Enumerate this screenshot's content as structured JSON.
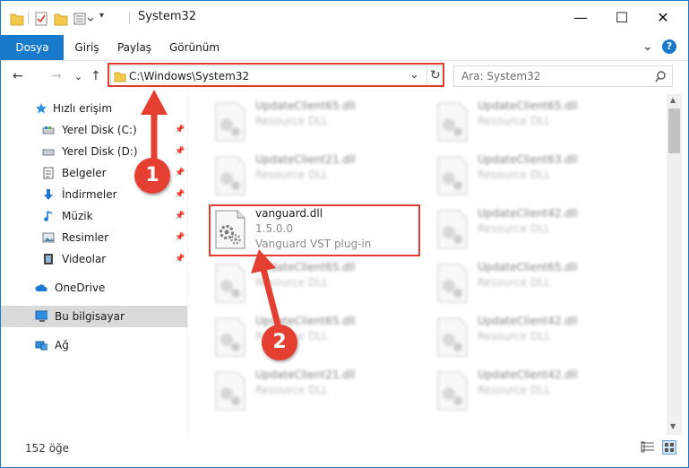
{
  "window": {
    "title": "System32",
    "minimize_glyph": "—",
    "maximize_glyph": "☐",
    "close_glyph": "✕",
    "help_glyph": "?",
    "expand_ribbon_glyph": "⌄"
  },
  "ribbon": {
    "tabs": [
      {
        "label": "Dosya"
      },
      {
        "label": "Giriş"
      },
      {
        "label": "Paylaş"
      },
      {
        "label": "Görünüm"
      }
    ]
  },
  "address": {
    "path": "C:\\Windows\\System32",
    "dropdown_glyph": "⌄",
    "refresh_glyph": "↻"
  },
  "nav_buttons": {
    "back": "←",
    "forward": "→",
    "recent": "⌄",
    "up": "↑"
  },
  "search": {
    "placeholder": "Ara: System32",
    "icon": "search-icon"
  },
  "nav_pane": {
    "items": [
      {
        "label": "Hızlı erişim",
        "icon": "star-icon",
        "pinned": false
      },
      {
        "label": "Yerel Disk (C:)",
        "icon": "drive-icon",
        "pinned": true
      },
      {
        "label": "Yerel Disk (D:)",
        "icon": "drive-icon",
        "pinned": true
      },
      {
        "label": "Belgeler",
        "icon": "documents-icon",
        "pinned": true
      },
      {
        "label": "İndirmeler",
        "icon": "download-icon",
        "pinned": true
      },
      {
        "label": "Müzik",
        "icon": "music-icon",
        "pinned": true
      },
      {
        "label": "Resimler",
        "icon": "pictures-icon",
        "pinned": true
      },
      {
        "label": "Videolar",
        "icon": "videos-icon",
        "pinned": true
      },
      {
        "label": "OneDrive",
        "icon": "cloud-icon",
        "pinned": false
      },
      {
        "label": "Bu bilgisayar",
        "icon": "computer-icon",
        "pinned": false,
        "selected": true
      },
      {
        "label": "Ağ",
        "icon": "network-icon",
        "pinned": false
      }
    ]
  },
  "files": {
    "left": [
      {
        "name": "UpdateClient65.dll",
        "desc": "Resource DLL"
      },
      {
        "name": "UpdateClient21.dll",
        "desc": "Resource DLL"
      },
      {
        "name": "vanguard.dll",
        "version": "1.5.0.0",
        "desc": "Vanguard VST plug-in",
        "highlighted": true
      },
      {
        "name": "UpdateClient65.dll",
        "desc": "Resource DLL"
      },
      {
        "name": "UpdateClient65.dll",
        "desc": "Resource DLL"
      },
      {
        "name": "UpdateClient21.dll",
        "desc": "Resource DLL"
      }
    ],
    "right": [
      {
        "name": "UpdateClient65.dll",
        "desc": "Resource DLL"
      },
      {
        "name": "UpdateClient63.dll",
        "desc": "Resource DLL"
      },
      {
        "name": "UpdateClient42.dll",
        "desc": "Resource DLL"
      },
      {
        "name": "UpdateClient65.dll",
        "desc": "Resource DLL"
      },
      {
        "name": "UpdateClient42.dll",
        "desc": "Resource DLL"
      },
      {
        "name": "UpdateClient42.dll",
        "desc": "Resource DLL"
      }
    ]
  },
  "status": {
    "item_count": "152 öğe"
  },
  "annotations": {
    "step1": "1",
    "step2": "2",
    "color": "#e53f32"
  },
  "colors": {
    "accent": "#1979ca",
    "highlight_box": "#e03c31"
  }
}
